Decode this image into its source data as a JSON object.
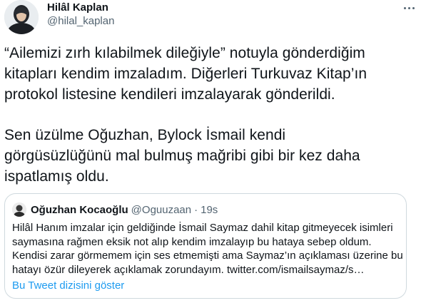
{
  "author": {
    "name": "Hilâl Kaplan",
    "handle": "@hilal_kaplan"
  },
  "tweet": {
    "paragraphs": [
      "“Ailemizi zırh kılabilmek dileğiyle” notuyla gönderdiğim\nkitapları kendim imzaladım. Diğerleri Turkuvaz Kitap’ın\nprotokol listesine kendileri imzalayarak gönderildi.",
      "Sen üzülme Oğuzhan, Bylock İsmail kendi\ngörgüsüzlüğünü mal bulmuş mağribi gibi bir kez daha\nispatlamış oldu."
    ]
  },
  "quoted_tweet": {
    "name": "Oğuzhan Kocaoğlu",
    "handle": "@Oguuzaan",
    "separator": "·",
    "time": "19s",
    "lines": [
      "Hilâl Hanım imzalar için geldiğinde İsmail Saymaz dahil kitap gitmeyecek isimleri",
      "saymasına rağmen eksik not alıp kendim imzalayıp bu hataya sebep oldum.",
      "Kendisi zarar görmemem için ses etmemişti ama Saymaz’ın açıklaması üzerine bu",
      "hatayı özür dileyerek açıklamak zorundayım. twitter.com/ismailsaymaz/s…"
    ],
    "show_thread_label": "Bu Tweet dizisini göster"
  },
  "icons": {
    "more": "more-horizontal-icon"
  },
  "colors": {
    "text": "#0f1419",
    "secondary": "#536471",
    "link": "#1d9bf0",
    "border": "#cfd9de"
  }
}
